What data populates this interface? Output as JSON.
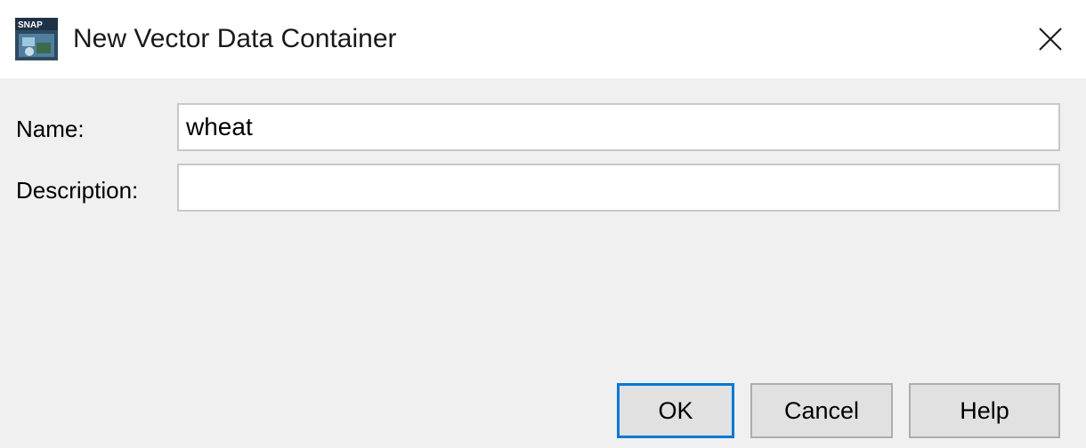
{
  "window": {
    "title": "New Vector Data Container",
    "app_icon": "snap-app-icon",
    "close_icon": "close-icon"
  },
  "form": {
    "name_label": "Name:",
    "name_value": "wheat",
    "description_label": "Description:",
    "description_value": ""
  },
  "buttons": {
    "ok_label": "OK",
    "cancel_label": "Cancel",
    "help_label": "Help"
  },
  "colors": {
    "focus_border": "#0078d7",
    "dialog_background": "#f0f0f0",
    "button_background": "#e1e1e1"
  }
}
